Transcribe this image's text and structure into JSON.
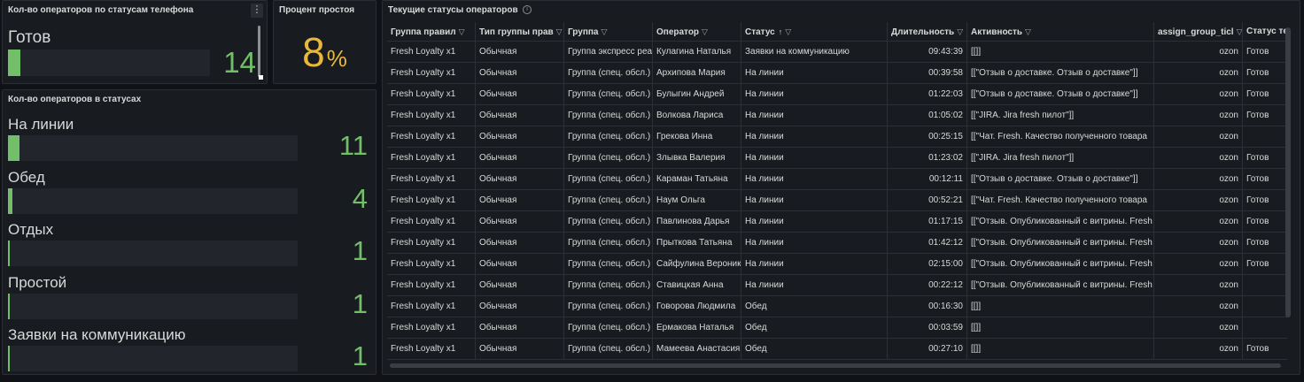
{
  "panel_phone_status": {
    "title": "Кол-во операторов по статусам телефона",
    "menu_glyph": "⋮",
    "label": "Готов",
    "value": "14",
    "fill_fraction": 0.06
  },
  "panel_idle": {
    "title": "Процент простоя",
    "value": "8",
    "unit": "%"
  },
  "panel_statuses": {
    "title": "Кол-во операторов в статусах",
    "rows": [
      {
        "label": "На линии",
        "value": "11",
        "fill_fraction": 0.04
      },
      {
        "label": "Обед",
        "value": "4",
        "fill_fraction": 0.015
      },
      {
        "label": "Отдых",
        "value": "1",
        "fill_fraction": 0.004
      },
      {
        "label": "Простой",
        "value": "1",
        "fill_fraction": 0.004
      },
      {
        "label": "Заявки на коммуникацию",
        "value": "1",
        "fill_fraction": 0.004
      }
    ]
  },
  "panel_table": {
    "title": "Текущие статусы операторов",
    "info_glyph": "i",
    "columns": [
      {
        "label": "Группа правил",
        "filter": true
      },
      {
        "label": "Тип группы прав",
        "filter": true
      },
      {
        "label": "Группа",
        "filter": true
      },
      {
        "label": "Оператор",
        "filter": true
      },
      {
        "label": "Статус",
        "filter": true,
        "sort": "↑"
      },
      {
        "label": "Длительность",
        "filter": true
      },
      {
        "label": "Активность",
        "filter": true
      },
      {
        "label": "assign_group_ticl",
        "filter": true
      },
      {
        "label": "Статус теле",
        "filter": false
      }
    ],
    "rows": [
      [
        "Fresh Loyalty x1",
        "Обычная",
        "Группа экспресс реа",
        "Кулагина Наталья",
        "Заявки на коммуникацию",
        "09:43:39",
        "[[]]",
        "ozon",
        "Готов"
      ],
      [
        "Fresh Loyalty x1",
        "Обычная",
        "Группа (спец. обсл.)",
        "Архипова Мария",
        "На линии",
        "00:39:58",
        "[[\"Отзыв о доставке. Отзыв о доставке\"]]",
        "ozon",
        "Готов"
      ],
      [
        "Fresh Loyalty x1",
        "Обычная",
        "Группа (спец. обсл.)",
        "Булыгин Андрей",
        "На линии",
        "01:22:03",
        "[[\"Отзыв о доставке. Отзыв о доставке\"]]",
        "ozon",
        "Готов"
      ],
      [
        "Fresh Loyalty x1",
        "Обычная",
        "Группа (спец. обсл.)",
        "Волкова Лариса",
        "На линии",
        "01:05:02",
        "[[\"JIRA. Jira fresh пилот\"]]",
        "ozon",
        "Готов"
      ],
      [
        "Fresh Loyalty x1",
        "Обычная",
        "Группа (спец. обсл.)",
        "Грекова Инна",
        "На линии",
        "00:25:15",
        "[[\"Чат. Fresh. Качество полученного товара",
        "ozon",
        ""
      ],
      [
        "Fresh Loyalty x1",
        "Обычная",
        "Группа (спец. обсл.)",
        "Злывка Валерия",
        "На линии",
        "01:23:02",
        "[[\"JIRA. Jira fresh пилот\"]]",
        "ozon",
        "Готов"
      ],
      [
        "Fresh Loyalty x1",
        "Обычная",
        "Группа (спец. обсл.)",
        "Караман Татьяна",
        "На линии",
        "00:12:11",
        "[[\"Отзыв о доставке. Отзыв о доставке\"]]",
        "ozon",
        "Готов"
      ],
      [
        "Fresh Loyalty x1",
        "Обычная",
        "Группа (спец. обсл.)",
        "Наум Ольга",
        "На линии",
        "00:52:21",
        "[[\"Чат. Fresh. Качество полученного товара",
        "ozon",
        "Готов"
      ],
      [
        "Fresh Loyalty x1",
        "Обычная",
        "Группа (спец. обсл.)",
        "Павлинова Дарья",
        "На линии",
        "01:17:15",
        "[[\"Отзыв. Опубликованный с витрины. Fresh",
        "ozon",
        "Готов"
      ],
      [
        "Fresh Loyalty x1",
        "Обычная",
        "Группа (спец. обсл.)",
        "Прыткова Татьяна",
        "На линии",
        "01:42:12",
        "[[\"Отзыв. Опубликованный с витрины. Fresh",
        "ozon",
        "Готов"
      ],
      [
        "Fresh Loyalty x1",
        "Обычная",
        "Группа (спец. обсл.)",
        "Сайфулина Вероника",
        "На линии",
        "02:15:00",
        "[[\"Отзыв. Опубликованный с витрины. Fresh",
        "ozon",
        "Готов"
      ],
      [
        "Fresh Loyalty x1",
        "Обычная",
        "Группа (спец. обсл.)",
        "Ставицкая Анна",
        "На линии",
        "00:22:12",
        "[[\"Отзыв. Опубликованный с витрины. Fresh",
        "ozon",
        ""
      ],
      [
        "Fresh Loyalty x1",
        "Обычная",
        "Группа (спец. обсл.)",
        "Говорова Людмила",
        "Обед",
        "00:16:30",
        "[[]]",
        "ozon",
        ""
      ],
      [
        "Fresh Loyalty x1",
        "Обычная",
        "Группа (спец. обсл.)",
        "Ермакова Наталья",
        "Обед",
        "00:03:59",
        "[[]]",
        "ozon",
        ""
      ],
      [
        "Fresh Loyalty x1",
        "Обычная",
        "Группа (спец. обсл.)",
        "Мамеева Анастасия",
        "Обед",
        "00:27:10",
        "[[]]",
        "ozon",
        "Готов"
      ]
    ]
  }
}
